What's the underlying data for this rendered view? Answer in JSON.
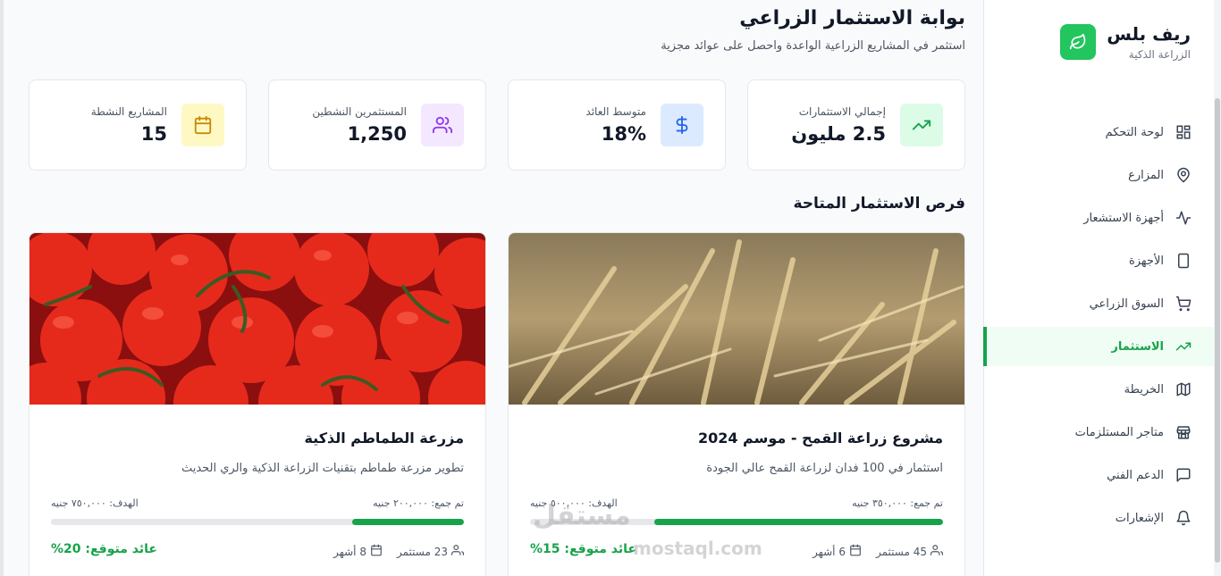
{
  "brand": {
    "name": "ريف بلس",
    "subtitle": "الزراعة الذكية"
  },
  "nav": [
    {
      "label": "لوحة التحكم",
      "icon": "dashboard-icon"
    },
    {
      "label": "المزارع",
      "icon": "map-pin-icon"
    },
    {
      "label": "أجهزة الاستشعار",
      "icon": "activity-icon"
    },
    {
      "label": "الأجهزة",
      "icon": "tablet-icon"
    },
    {
      "label": "السوق الزراعي",
      "icon": "cart-icon"
    },
    {
      "label": "الاستثمار",
      "icon": "trending-up-icon",
      "active": true
    },
    {
      "label": "الخريطة",
      "icon": "map-icon"
    },
    {
      "label": "متاجر المستلزمات",
      "icon": "store-icon"
    },
    {
      "label": "الدعم الفني",
      "icon": "chat-icon"
    },
    {
      "label": "الإشعارات",
      "icon": "bell-icon"
    }
  ],
  "page": {
    "title": "بوابة الاستثمار الزراعي",
    "subtitle": "استثمر في المشاريع الزراعية الواعدة واحصل على عوائد مجزية"
  },
  "stats": [
    {
      "label": "إجمالي الاستثمارات",
      "value": "2.5 مليون",
      "icon": "trending-up-icon",
      "color": "#dcfce7",
      "fg": "#16a34a"
    },
    {
      "label": "متوسط العائد",
      "value": "18%",
      "icon": "dollar-icon",
      "color": "#dbeafe",
      "fg": "#2563eb"
    },
    {
      "label": "المستثمرين النشطين",
      "value": "1,250",
      "icon": "users-icon",
      "color": "#f3e8ff",
      "fg": "#9333ea"
    },
    {
      "label": "المشاريع النشطة",
      "value": "15",
      "icon": "calendar-icon",
      "color": "#fef9c3",
      "fg": "#ca8a04"
    }
  ],
  "section_title": "فرص الاستثمار المتاحة",
  "projects": [
    {
      "title": "مشروع زراعة القمح - موسم 2024",
      "description": "استثمار في 100 فدان لزراعة القمح عالي الجودة",
      "raised": "تم جمع: ٣٥٠,٠٠٠ جنيه",
      "target": "الهدف: ٥٠٠,٠٠٠ جنيه",
      "progress": 0.7,
      "investors": "45 مستثمر",
      "duration": "6 أشهر",
      "expected_return": "عائد متوقع: 15%",
      "image": "wheat-image"
    },
    {
      "title": "مزرعة الطماطم الذكية",
      "description": "تطوير مزرعة طماطم بتقنيات الزراعة الذكية والري الحديث",
      "raised": "تم جمع: ٢٠٠,٠٠٠ جنيه",
      "target": "الهدف: ٧٥٠,٠٠٠ جنيه",
      "progress": 0.27,
      "investors": "23 مستثمر",
      "duration": "8 أشهر",
      "expected_return": "عائد متوقع: 20%",
      "image": "tomato-image"
    }
  ],
  "watermark": {
    "main": "مستقل",
    "sub": "mostaql.com"
  }
}
